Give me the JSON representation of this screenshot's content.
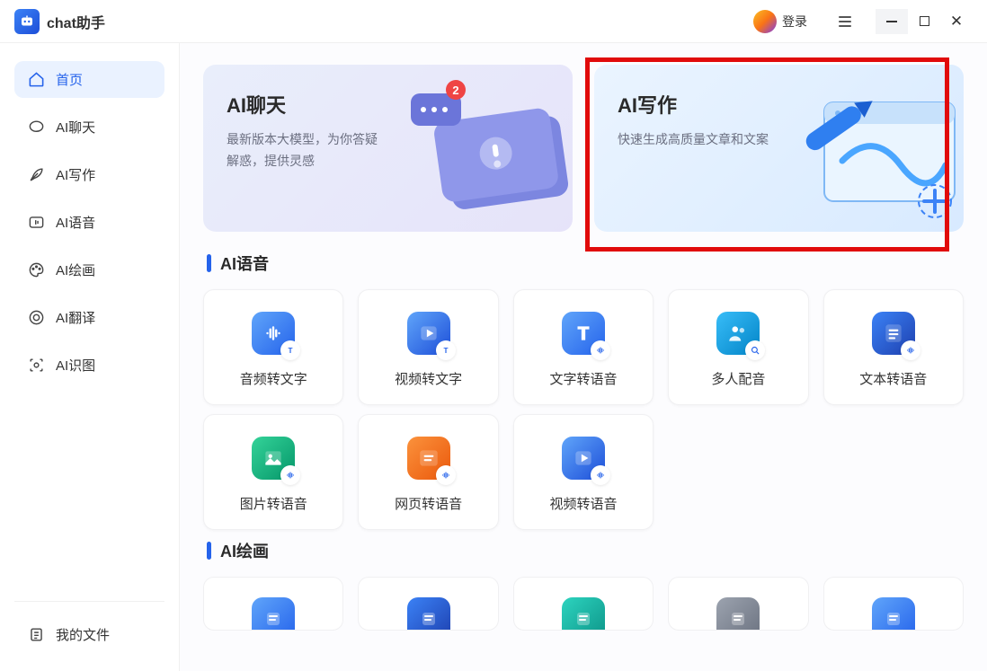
{
  "app": {
    "title": "chat助手",
    "login": "登录"
  },
  "sidebar": {
    "items": [
      {
        "label": "首页"
      },
      {
        "label": "AI聊天"
      },
      {
        "label": "AI写作"
      },
      {
        "label": "AI语音"
      },
      {
        "label": "AI绘画"
      },
      {
        "label": "AI翻译"
      },
      {
        "label": "AI识图"
      }
    ],
    "footer": {
      "label": "我的文件"
    }
  },
  "hero": {
    "chat": {
      "title": "AI聊天",
      "subtitle": "最新版本大模型，为你答疑解惑，提供灵感",
      "badge": "2"
    },
    "write": {
      "title": "AI写作",
      "subtitle": "快速生成高质量文章和文案"
    }
  },
  "sections": {
    "voice": {
      "title": "AI语音"
    },
    "paint": {
      "title": "AI绘画"
    }
  },
  "voice_tools": [
    {
      "label": "音频转文字",
      "gradient": "linear-gradient(135deg,#60a5fa,#2563eb)"
    },
    {
      "label": "视频转文字",
      "gradient": "linear-gradient(135deg,#60a5fa,#1d4ed8)"
    },
    {
      "label": "文字转语音",
      "gradient": "linear-gradient(135deg,#60a5fa,#2563eb)"
    },
    {
      "label": "多人配音",
      "gradient": "linear-gradient(135deg,#38bdf8,#0284c7)"
    },
    {
      "label": "文本转语音",
      "gradient": "linear-gradient(135deg,#3b82f6,#1e40af)"
    },
    {
      "label": "图片转语音",
      "gradient": "linear-gradient(135deg,#34d399,#059669)"
    },
    {
      "label": "网页转语音",
      "gradient": "linear-gradient(135deg,#fb923c,#ea580c)"
    },
    {
      "label": "视频转语音",
      "gradient": "linear-gradient(135deg,#60a5fa,#1d4ed8)"
    }
  ],
  "paint_tools_partial": [
    {
      "gradient": "linear-gradient(135deg,#60a5fa,#2563eb)"
    },
    {
      "gradient": "linear-gradient(135deg,#3b82f6,#1e40af)"
    },
    {
      "gradient": "linear-gradient(135deg,#2dd4bf,#0d9488)"
    },
    {
      "gradient": "linear-gradient(135deg,#9ca3af,#6b7280)"
    },
    {
      "gradient": "linear-gradient(135deg,#60a5fa,#2563eb)"
    }
  ]
}
